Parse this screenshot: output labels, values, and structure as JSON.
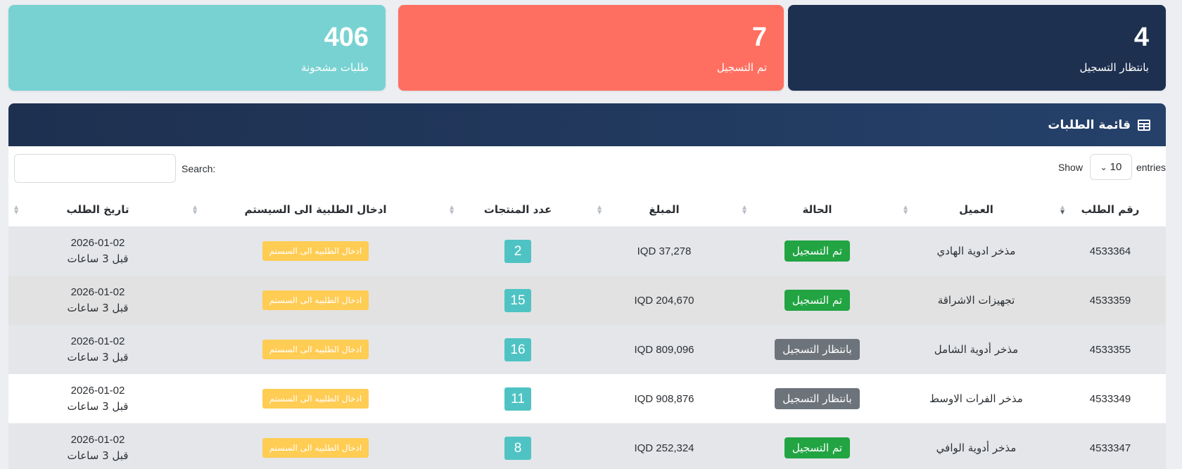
{
  "stats": {
    "pending": {
      "value": "4",
      "label": "بانتظار التسجيل",
      "color": "#1e3050"
    },
    "registered": {
      "value": "7",
      "label": "تم التسجيل",
      "color": "#ff6f61"
    },
    "shipped": {
      "value": "406",
      "label": "طلبات مشحونة",
      "color": "#79d2d2"
    }
  },
  "panel": {
    "title": "قائمة الطلبات",
    "icon": "table-icon"
  },
  "controls": {
    "show_label": "Show",
    "entries_value": "10",
    "entries_label": "entries",
    "search_label": "Search:",
    "search_value": ""
  },
  "table": {
    "headers": [
      "رقم الطلب",
      "العميل",
      "الحالة",
      "المبلغ",
      "عدد المنتجات",
      "ادخال الطلبية الى السيستم",
      "تاريخ الطلب"
    ],
    "rows": [
      {
        "order_no": "4533364",
        "client": "مذخر ادوية الهادي",
        "status": "تم التسجيل",
        "status_type": "registered",
        "amount": "IQD 37,278",
        "count": "2",
        "action": "ادخال الطلبيه الى السستم",
        "date": "2026-01-02",
        "ago": "قبل 3 ساعات"
      },
      {
        "order_no": "4533359",
        "client": "تجهيزات الاشراقة",
        "status": "تم التسجيل",
        "status_type": "registered",
        "amount": "IQD 204,670",
        "count": "15",
        "action": "ادخال الطلبيه الى السستم",
        "date": "2026-01-02",
        "ago": "قبل 3 ساعات"
      },
      {
        "order_no": "4533355",
        "client": "مذخر أدوية الشامل",
        "status": "بانتظار التسجيل",
        "status_type": "pending",
        "amount": "IQD 809,096",
        "count": "16",
        "action": "ادخال الطلبيه الى السستم",
        "date": "2026-01-02",
        "ago": "قبل 3 ساعات"
      },
      {
        "order_no": "4533349",
        "client": "مذخر الفرات الاوسط",
        "status": "بانتظار التسجيل",
        "status_type": "pending",
        "amount": "IQD 908,876",
        "count": "11",
        "action": "ادخال الطلبيه الى السستم",
        "date": "2026-01-02",
        "ago": "قبل 3 ساعات"
      },
      {
        "order_no": "4533347",
        "client": "مذخر أدوية الوافي",
        "status": "تم التسجيل",
        "status_type": "registered",
        "amount": "IQD 252,324",
        "count": "8",
        "action": "ادخال الطلبيه الى السستم",
        "date": "2026-01-02",
        "ago": "قبل 3 ساعات"
      }
    ]
  }
}
